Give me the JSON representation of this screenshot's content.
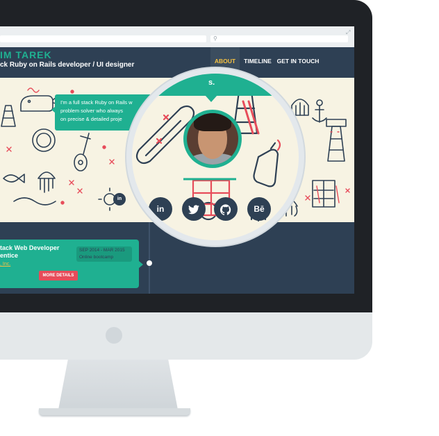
{
  "header": {
    "site_name": "IM TAREK",
    "tagline": "ck Ruby on Rails developer / UI designer"
  },
  "nav": {
    "items": [
      "ABOUT",
      "TIMELINE",
      "GET IN TOUCH"
    ],
    "active": "ABOUT"
  },
  "hero": {
    "bio_lines": [
      "I'm a full stack Ruby on Rails w",
      "problem solver who always",
      "on precise & detailed proje"
    ],
    "small_social": "in"
  },
  "magnifier": {
    "bar_text": "s.",
    "social": [
      "in",
      "twitter",
      "github",
      "Bē"
    ]
  },
  "timeline": {
    "title": "tack Web Developer",
    "role": "entice",
    "company": ", Inc.",
    "date_range": "SEP 2014 - MAR 2015",
    "date_sub": "Online bootcamp",
    "button": "MORE DETAILS"
  },
  "colors": {
    "accent": "#1fb091",
    "navy": "#2e4054",
    "highlight": "#f5c142",
    "button": "#e74c5a",
    "cream": "#f7f3e3"
  }
}
